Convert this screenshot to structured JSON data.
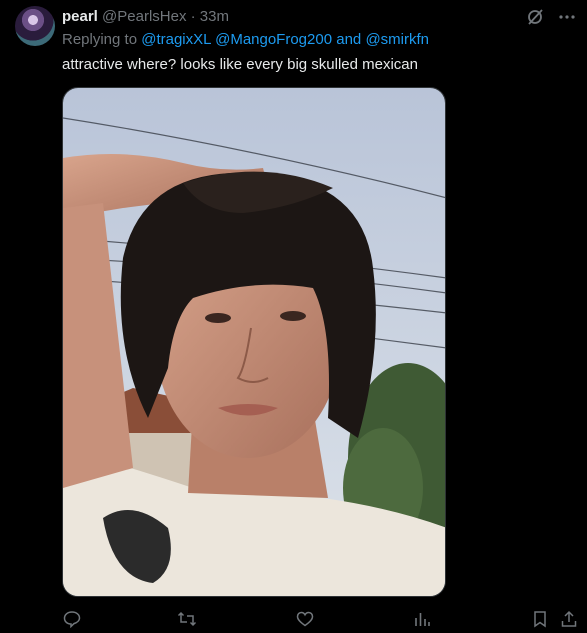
{
  "tweet": {
    "author_name": "pearl",
    "author_handle": "@PearlsHex",
    "separator": "·",
    "time": "33m",
    "reply_prefix": "Replying to",
    "mention_1": "@tragixXL",
    "mention_2": "@MangoFrog200",
    "reply_and": "and",
    "mention_3": "@smirkfn",
    "text": "attractive where? looks like every big skulled mexican"
  },
  "icons": {
    "grok": "grok-icon",
    "more": "more-icon",
    "reply": "reply-icon",
    "retweet": "retweet-icon",
    "like": "like-icon",
    "views": "views-icon",
    "bookmark": "bookmark-icon",
    "share": "share-icon"
  },
  "colors": {
    "background": "#000000",
    "text": "#e7e9ea",
    "muted": "#71767b",
    "link": "#1d9bf0"
  }
}
